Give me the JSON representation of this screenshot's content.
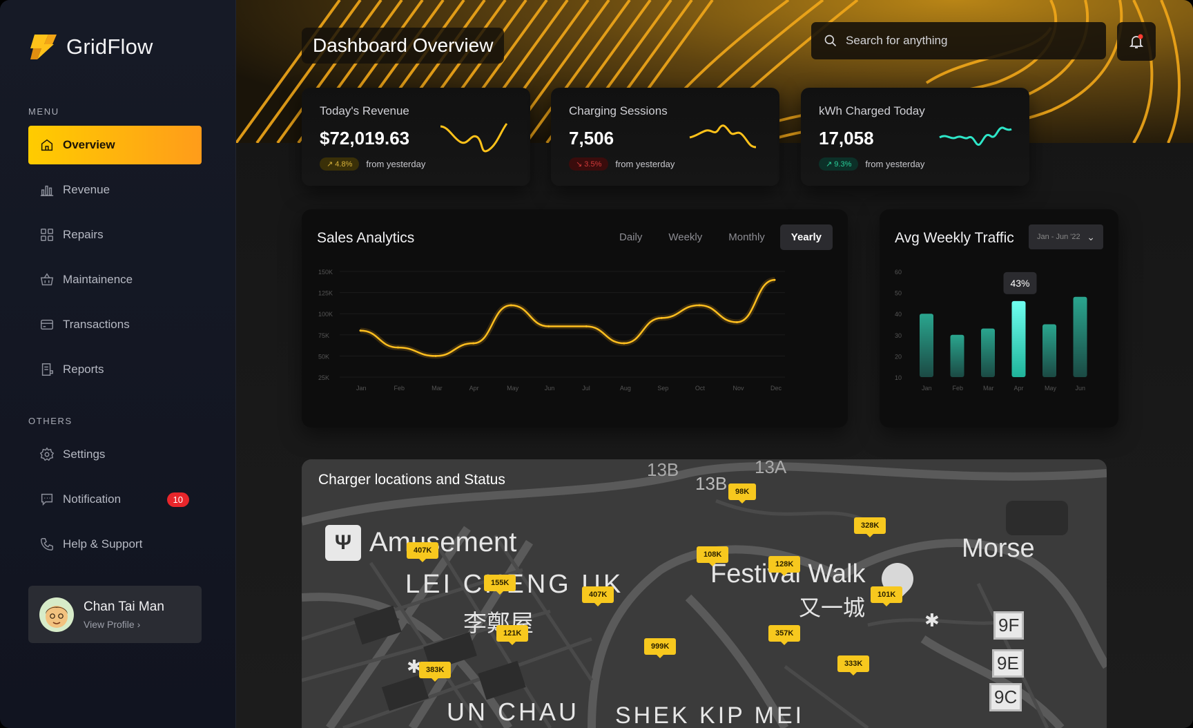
{
  "app": {
    "name": "GridFlow"
  },
  "sidebar": {
    "menu_label": "MENU",
    "others_label": "OTHERS",
    "items": [
      {
        "label": "Overview",
        "icon": "home-icon"
      },
      {
        "label": "Revenue",
        "icon": "bar-chart-icon"
      },
      {
        "label": "Repairs",
        "icon": "grid-icon"
      },
      {
        "label": "Maintainence",
        "icon": "basket-icon"
      },
      {
        "label": "Transactions",
        "icon": "card-icon"
      },
      {
        "label": "Reports",
        "icon": "report-icon"
      }
    ],
    "others": [
      {
        "label": "Settings",
        "icon": "gear-icon"
      },
      {
        "label": "Notification",
        "icon": "chat-icon",
        "badge": "10"
      },
      {
        "label": "Help & Support",
        "icon": "phone-icon"
      }
    ],
    "profile": {
      "name": "Chan Tai Man",
      "link": "View Profile"
    }
  },
  "header": {
    "title": "Dashboard Overview",
    "search_placeholder": "Search for anything"
  },
  "stats": [
    {
      "label": "Today's Revenue",
      "value": "$72,019.63",
      "change": "4.8%",
      "direction": "up",
      "suffix": "from yesterday",
      "color": "#ffc21a"
    },
    {
      "label": "Charging Sessions",
      "value": "7,506",
      "change": "3.5%",
      "direction": "down",
      "suffix": "from yesterday",
      "color": "#ffc21a"
    },
    {
      "label": "kWh Charged Today",
      "value": "17,058",
      "change": "9.3%",
      "direction": "up",
      "suffix": "from yesterday",
      "color": "#2ee6c8"
    }
  ],
  "sales": {
    "title": "Sales Analytics",
    "tabs": [
      "Daily",
      "Weekly",
      "Monthly",
      "Yearly"
    ],
    "active_tab": "Yearly"
  },
  "traffic": {
    "title": "Avg Weekly Traffic",
    "range": "Jan - Jun '22",
    "tooltip": "43%"
  },
  "chart_data": [
    {
      "type": "line",
      "categories": [
        "Jan",
        "Feb",
        "Mar",
        "Apr",
        "May",
        "Jun",
        "Jul",
        "Aug",
        "Sep",
        "Oct",
        "Nov",
        "Dec"
      ],
      "yticks": [
        "150K",
        "125K",
        "100K",
        "75K",
        "50K",
        "25K"
      ],
      "ylim": [
        25000,
        150000
      ],
      "series": [
        {
          "values": [
            80000,
            60000,
            50000,
            65000,
            110000,
            85000,
            85000,
            65000,
            95000,
            110000,
            90000,
            140000
          ]
        }
      ]
    },
    {
      "type": "bar",
      "categories": [
        "Jan",
        "Feb",
        "Mar",
        "Apr",
        "May",
        "Jun"
      ],
      "yticks": [
        "60",
        "50",
        "40",
        "30",
        "20",
        "10"
      ],
      "ylim": [
        10,
        60
      ],
      "values": [
        40,
        30,
        33,
        46,
        35,
        48
      ],
      "highlight_index": 3
    }
  ],
  "map": {
    "title": "Charger locations and Status",
    "places": [
      "Amusement",
      "LEI CHENG UK",
      "李鄭屋",
      "Festival Walk",
      "又一城",
      "UN CHAU",
      "SHEK KIP MEI",
      "Morse"
    ],
    "route_signs": [
      "13B",
      "13B",
      "13A",
      "9F",
      "9E",
      "9C"
    ],
    "tags": [
      "98K",
      "328K",
      "407K",
      "108K",
      "128K",
      "155K",
      "407K",
      "101K",
      "121K",
      "357K",
      "999K",
      "383K",
      "333K"
    ]
  }
}
